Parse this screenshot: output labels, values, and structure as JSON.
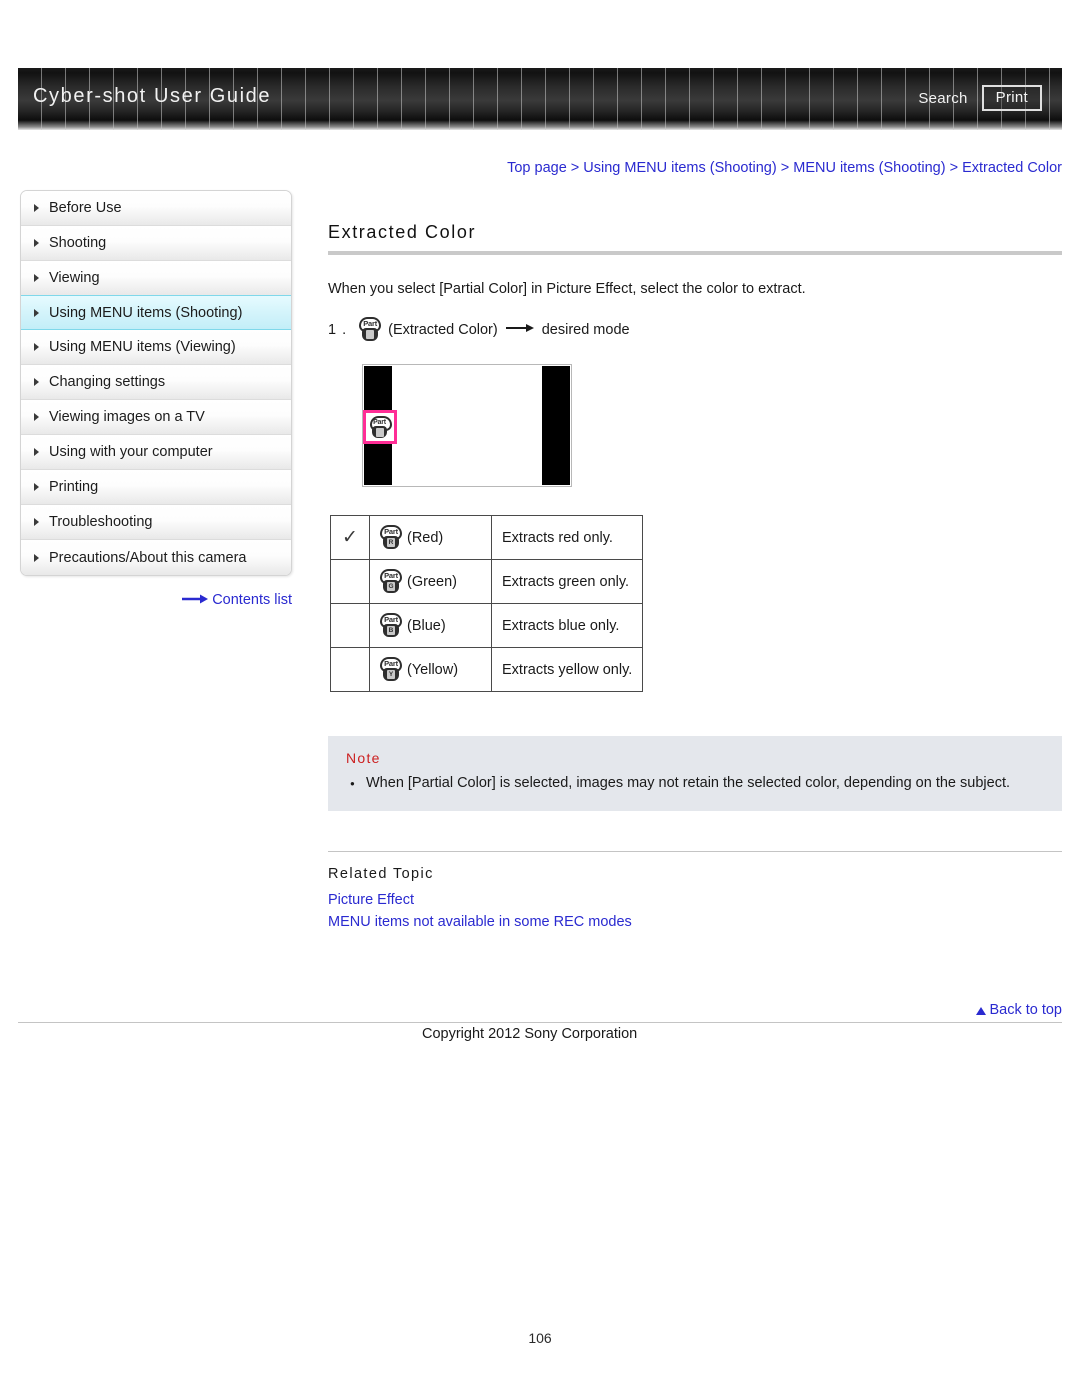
{
  "header": {
    "title": "Cyber-shot User Guide",
    "search_label": "Search",
    "print_label": "Print"
  },
  "breadcrumb": {
    "items": [
      "Top page",
      "Using MENU items (Shooting)",
      "MENU items (Shooting)",
      "Extracted Color"
    ],
    "separator": ">"
  },
  "sidebar": {
    "items": [
      {
        "label": "Before Use",
        "selected": false
      },
      {
        "label": "Shooting",
        "selected": false
      },
      {
        "label": "Viewing",
        "selected": false
      },
      {
        "label": "Using MENU items (Shooting)",
        "selected": true
      },
      {
        "label": "Using MENU items (Viewing)",
        "selected": false
      },
      {
        "label": "Changing settings",
        "selected": false
      },
      {
        "label": "Viewing images on a TV",
        "selected": false
      },
      {
        "label": "Using with your computer",
        "selected": false
      },
      {
        "label": "Printing",
        "selected": false
      },
      {
        "label": "Troubleshooting",
        "selected": false
      },
      {
        "label": "Precautions/About this camera",
        "selected": false
      }
    ],
    "contents_link": "Contents list"
  },
  "main": {
    "page_title": "Extracted Color",
    "intro": "When you select [Partial Color] in Picture Effect, select the color to extract.",
    "step": {
      "number": "1 .",
      "icon_letter": "",
      "icon_caption": "(Extracted Color)",
      "arrow": "⟶",
      "target": "desired mode"
    },
    "screen_illustration": {
      "highlighted_icon_letter": ""
    },
    "options_table": {
      "rows": [
        {
          "checked": true,
          "check_glyph": "✓",
          "icon_letter": "R",
          "name": "(Red)",
          "description": "Extracts red only."
        },
        {
          "checked": false,
          "check_glyph": "",
          "icon_letter": "G",
          "name": "(Green)",
          "description": "Extracts green only."
        },
        {
          "checked": false,
          "check_glyph": "",
          "icon_letter": "B",
          "name": "(Blue)",
          "description": "Extracts blue only."
        },
        {
          "checked": false,
          "check_glyph": "",
          "icon_letter": "Y",
          "name": "(Yellow)",
          "description": "Extracts yellow only."
        }
      ]
    },
    "note": {
      "title": "Note",
      "items": [
        "When [Partial Color] is selected, images may not retain the selected color, depending on the subject."
      ]
    },
    "related": {
      "title": "Related Topic",
      "links": [
        "Picture Effect",
        "MENU items not available in some REC modes"
      ]
    }
  },
  "footer": {
    "back_to_top": "Back to top",
    "copyright": "Copyright 2012 Sony Corporation",
    "page_number": "106"
  },
  "colors": {
    "link": "#2a2ad0",
    "note_title": "#cc2020",
    "highlight_box": "#ff2d96",
    "sidebar_selected": "#c3eef8"
  }
}
